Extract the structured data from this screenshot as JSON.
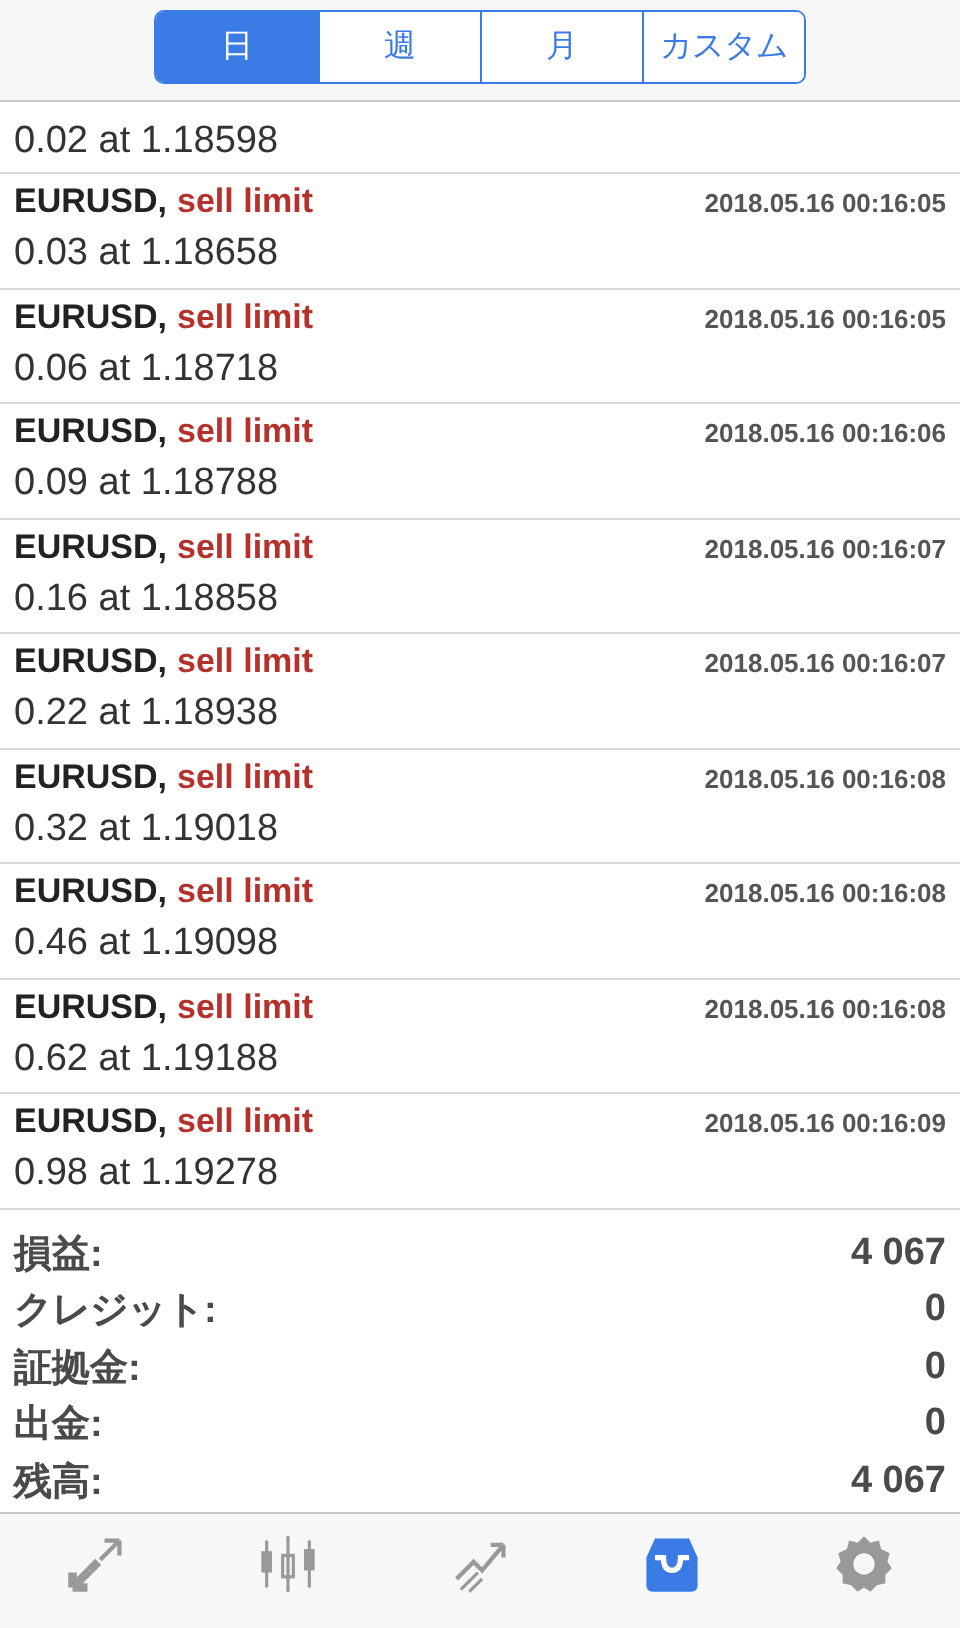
{
  "period_tabs": [
    {
      "label": "日",
      "selected": true
    },
    {
      "label": "週",
      "selected": false
    },
    {
      "label": "月",
      "selected": false
    },
    {
      "label": "カスタム",
      "selected": false
    }
  ],
  "partial_order": {
    "details": "0.02 at 1.18598"
  },
  "orders": [
    {
      "symbol": "EURUSD,",
      "type": "sell limit",
      "time": "2018.05.16 00:16:05",
      "details": "0.03 at 1.18658"
    },
    {
      "symbol": "EURUSD,",
      "type": "sell limit",
      "time": "2018.05.16 00:16:05",
      "details": "0.06 at 1.18718"
    },
    {
      "symbol": "EURUSD,",
      "type": "sell limit",
      "time": "2018.05.16 00:16:06",
      "details": "0.09 at 1.18788"
    },
    {
      "symbol": "EURUSD,",
      "type": "sell limit",
      "time": "2018.05.16 00:16:07",
      "details": "0.16 at 1.18858"
    },
    {
      "symbol": "EURUSD,",
      "type": "sell limit",
      "time": "2018.05.16 00:16:07",
      "details": "0.22 at 1.18938"
    },
    {
      "symbol": "EURUSD,",
      "type": "sell limit",
      "time": "2018.05.16 00:16:08",
      "details": "0.32 at 1.19018"
    },
    {
      "symbol": "EURUSD,",
      "type": "sell limit",
      "time": "2018.05.16 00:16:08",
      "details": "0.46 at 1.19098"
    },
    {
      "symbol": "EURUSD,",
      "type": "sell limit",
      "time": "2018.05.16 00:16:08",
      "details": "0.62 at 1.19188"
    },
    {
      "symbol": "EURUSD,",
      "type": "sell limit",
      "time": "2018.05.16 00:16:09",
      "details": "0.98 at 1.19278"
    }
  ],
  "summary": [
    {
      "label": "損益:",
      "value": "4 067"
    },
    {
      "label": "クレジット:",
      "value": "0"
    },
    {
      "label": "証拠金:",
      "value": "0"
    },
    {
      "label": "出金:",
      "value": "0"
    },
    {
      "label": "残高:",
      "value": "4 067"
    }
  ],
  "tab_bar": [
    {
      "kind": "quotes",
      "selected": false
    },
    {
      "kind": "chart",
      "selected": false
    },
    {
      "kind": "trade",
      "selected": false
    },
    {
      "kind": "history",
      "selected": true
    },
    {
      "kind": "settings",
      "selected": false
    }
  ]
}
